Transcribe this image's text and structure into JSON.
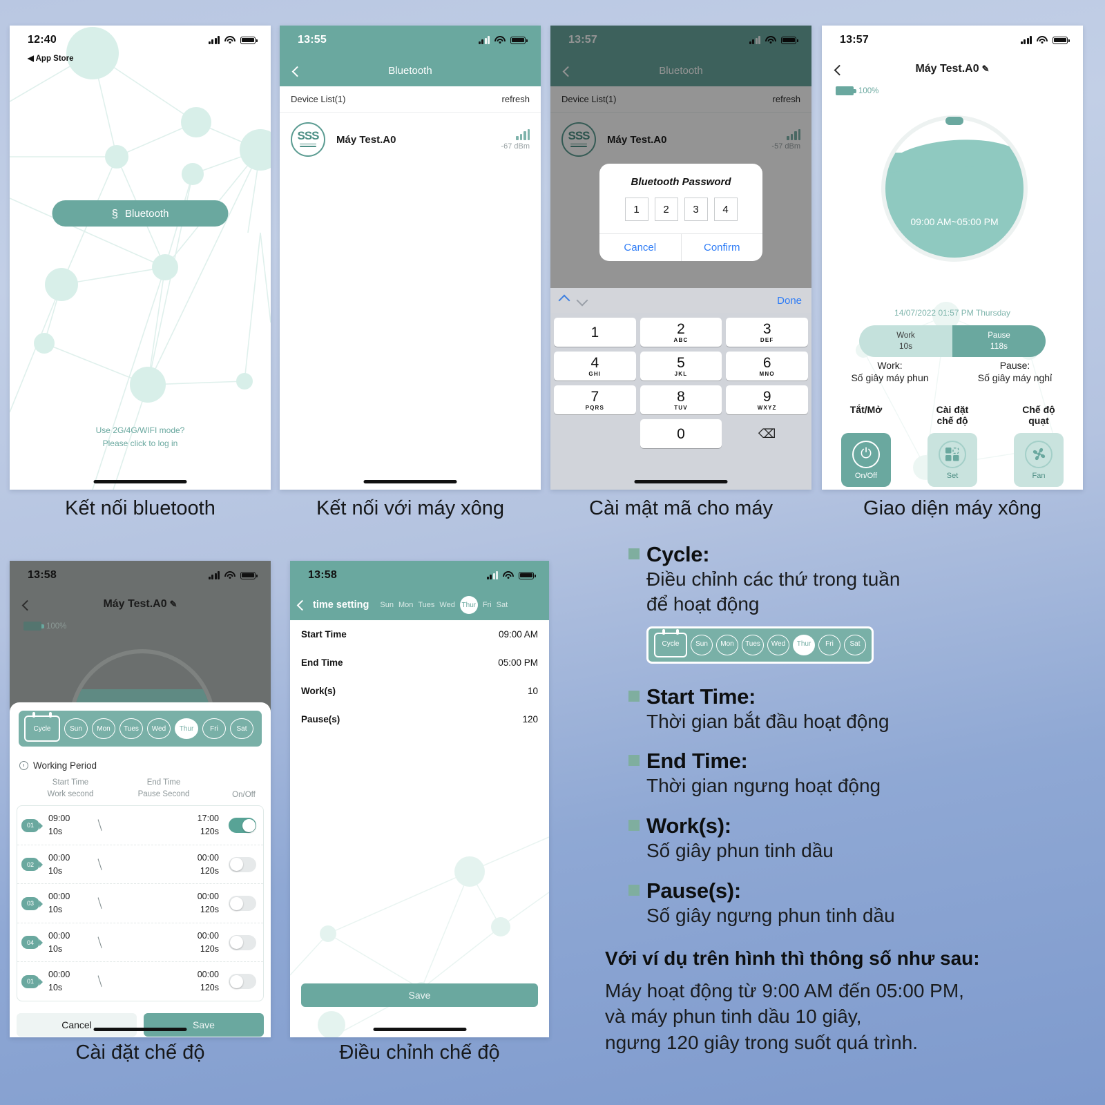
{
  "screens": {
    "p1": {
      "time": "12:40",
      "back_app": "◀ App Store",
      "bluetooth_button": "Bluetooth",
      "login_line1": "Use 2G/4G/WIFI mode?",
      "login_line2": "Please click to log in"
    },
    "p2": {
      "time": "13:55",
      "nav_title": "Bluetooth",
      "device_list_label": "Device List(1)",
      "refresh_label": "refresh",
      "device_name": "Máy Test.A0",
      "device_icon_text": "SSS",
      "signal": "-67 dBm"
    },
    "p3": {
      "time": "13:57",
      "nav_title": "Bluetooth",
      "device_list_label": "Device List(1)",
      "refresh_label": "refresh",
      "device_name": "Máy Test.A0",
      "device_icon_text": "SSS",
      "signal": "-57 dBm",
      "modal_title": "Bluetooth Password",
      "pin": [
        "1",
        "2",
        "3",
        "4"
      ],
      "cancel": "Cancel",
      "confirm": "Confirm",
      "keyboard_done": "Done",
      "keys": [
        {
          "num": "1",
          "sub": ""
        },
        {
          "num": "2",
          "sub": "ABC"
        },
        {
          "num": "3",
          "sub": "DEF"
        },
        {
          "num": "4",
          "sub": "GHI"
        },
        {
          "num": "5",
          "sub": "JKL"
        },
        {
          "num": "6",
          "sub": "MNO"
        },
        {
          "num": "7",
          "sub": "PQRS"
        },
        {
          "num": "8",
          "sub": "TUV"
        },
        {
          "num": "9",
          "sub": "WXYZ"
        },
        {
          "num": "0",
          "sub": ""
        }
      ],
      "backspace_icon": "⌫"
    },
    "p4": {
      "time": "13:57",
      "title": "Máy Test.A0",
      "edit_icon": "✎",
      "battery_pct": "100%",
      "dial_range": "09:00 AM~05:00 PM",
      "datetime": "14/07/2022 01:57 PM Thursday",
      "work_pill_label": "Work",
      "work_pill_value": "10s",
      "pause_pill_label": "Pause",
      "pause_pill_value": "118s",
      "legend_work": "Work:",
      "legend_work_desc": "Số giây máy phun",
      "legend_pause": "Pause:",
      "legend_pause_desc": "Số giây máy nghỉ",
      "ctrl_power_cap": "Tắt/Mở",
      "ctrl_power_label": "On/Off",
      "ctrl_power_icon": "⏻",
      "ctrl_set_cap": "Cài đặt chế độ",
      "ctrl_set_label": "Set",
      "ctrl_fan_cap": "Chế độ quạt",
      "ctrl_fan_label": "Fan",
      "ctrl_fan_icon": "❁"
    },
    "p5": {
      "time": "13:58",
      "title": "Máy Test.A0",
      "edit_icon": "✎",
      "battery_pct": "100%",
      "cycle_label": "Cycle",
      "days": [
        "Sun",
        "Mon",
        "Tues",
        "Wed",
        "Thur",
        "Fri",
        "Sat"
      ],
      "selected_day": "Thur",
      "working_period": "Working Period",
      "col_start_time": "Start Time",
      "col_end_time": "End Time",
      "col_work_second": "Work second",
      "col_pause_second": "Pause Second",
      "col_onoff": "On/Off",
      "rows": [
        {
          "no": "01",
          "start": "09:00",
          "work": "10s",
          "end": "17:00",
          "pause": "120s",
          "on": true
        },
        {
          "no": "02",
          "start": "00:00",
          "work": "10s",
          "end": "00:00",
          "pause": "120s",
          "on": false
        },
        {
          "no": "03",
          "start": "00:00",
          "work": "10s",
          "end": "00:00",
          "pause": "120s",
          "on": false
        },
        {
          "no": "04",
          "start": "00:00",
          "work": "10s",
          "end": "00:00",
          "pause": "120s",
          "on": false
        },
        {
          "no": "01",
          "start": "00:00",
          "work": "10s",
          "end": "00:00",
          "pause": "120s",
          "on": false
        }
      ],
      "cancel": "Cancel",
      "save": "Save"
    },
    "p6": {
      "time": "13:58",
      "nav_title": "time setting",
      "days": [
        "Sun",
        "Mon",
        "Tues",
        "Wed",
        "Thur",
        "Fri",
        "Sat"
      ],
      "selected_day": "Thur",
      "rows": [
        {
          "label": "Start Time",
          "value": "09:00 AM"
        },
        {
          "label": "End Time",
          "value": "05:00 PM"
        },
        {
          "label": "Work(s)",
          "value": "10"
        },
        {
          "label": "Pause(s)",
          "value": "120"
        }
      ],
      "save": "Save"
    }
  },
  "captions": {
    "c1": "Kết nối bluetooth",
    "c2": "Kết nối với máy xông",
    "c3": "Cài mật mã cho máy",
    "c4": "Giao diện máy xông",
    "c5": "Cài đặt chế độ",
    "c6": "Điều chỉnh chế độ"
  },
  "panel": {
    "items": [
      {
        "title": "Cycle:",
        "desc": "Điều chỉnh các thứ trong tuần để hoạt động"
      },
      {
        "title": "Start Time:",
        "desc": "Thời gian bắt đầu hoạt động"
      },
      {
        "title": "End Time:",
        "desc": "Thời gian ngưng hoạt động"
      },
      {
        "title": "Work(s):",
        "desc": "Số giây phun tinh dầu"
      },
      {
        "title": "Pause(s):",
        "desc": "Số giây ngưng phun tinh dầu"
      }
    ],
    "mini_cycle": {
      "label": "Cycle",
      "days": [
        "Sun",
        "Mon",
        "Tues",
        "Wed",
        "Thur",
        "Fri",
        "Sat"
      ],
      "selected_day": "Thur"
    },
    "footer_bold": "Với ví dụ trên hình thì thông số như sau:",
    "footer_line1": "Máy hoạt động từ 9:00 AM đến 05:00 PM,",
    "footer_line2": "và máy phun tinh dầu 10 giây,",
    "footer_line3": "ngưng 120 giây trong suốt quá trình."
  },
  "colors": {
    "teal": "#6aa89f",
    "teal_light": "#c4e1dc",
    "teal_pale": "#8fc9c0",
    "background_top": "#b9c7e2",
    "background_bottom": "#7e9acd"
  }
}
